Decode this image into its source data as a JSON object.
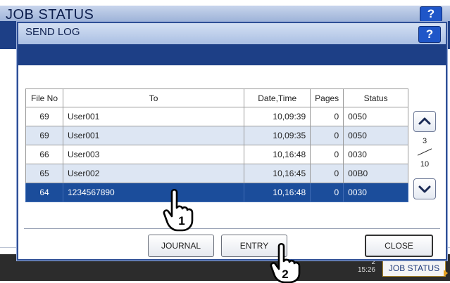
{
  "background_window": {
    "title": "JOB STATUS",
    "help_label": "?",
    "clock": "2",
    "time": "15:26",
    "job_status_button": "JOB STATUS"
  },
  "dialog": {
    "title": "SEND LOG",
    "help_label": "?"
  },
  "table": {
    "headers": [
      "File No",
      "To",
      "Date,Time",
      "Pages",
      "Status"
    ],
    "rows": [
      {
        "file_no": "69",
        "to": "User001",
        "date_time": "10,09:39",
        "pages": "0",
        "status": "0050"
      },
      {
        "file_no": "69",
        "to": "User001",
        "date_time": "10,09:35",
        "pages": "0",
        "status": "0050"
      },
      {
        "file_no": "66",
        "to": "User003",
        "date_time": "10,16:48",
        "pages": "0",
        "status": "0030"
      },
      {
        "file_no": "65",
        "to": "User002",
        "date_time": "10,16:45",
        "pages": "0",
        "status": "00B0"
      },
      {
        "file_no": "64",
        "to": "1234567890",
        "date_time": "10,16:48",
        "pages": "0",
        "status": "0030"
      }
    ],
    "selected_row_index": 4
  },
  "pagination": {
    "current": "3",
    "total": "10"
  },
  "buttons": {
    "journal": "JOURNAL",
    "entry": "ENTRY",
    "close": "CLOSE"
  },
  "callouts": {
    "first": "1",
    "second": "2"
  },
  "colors": {
    "header_blue": "#1d3f86",
    "selected_row": "#1b4d9b",
    "alt_row": "#dde6f3",
    "help_button": "#1f56c8"
  }
}
